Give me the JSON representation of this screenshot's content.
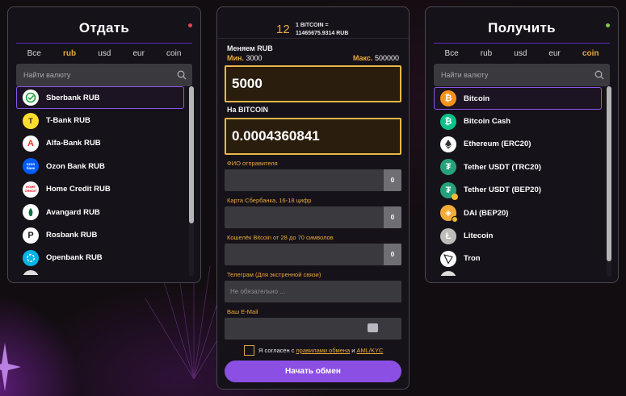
{
  "colors": {
    "accent_orange": "#e8a93a",
    "accent_purple": "#8b4fe3",
    "give_status_dot": "#e8414c",
    "get_status_dot": "#7ecb3f",
    "panel_bg": "#16121a"
  },
  "give": {
    "title": "Отдать",
    "tabs": [
      {
        "label": "Все",
        "active": false
      },
      {
        "label": "rub",
        "active": true
      },
      {
        "label": "usd",
        "active": false
      },
      {
        "label": "eur",
        "active": false
      },
      {
        "label": "coin",
        "active": false
      }
    ],
    "search_placeholder": "Найти валюту",
    "scroll_fraction": {
      "start": 0.0,
      "end": 0.72
    },
    "items": [
      {
        "label": "Sberbank RUB",
        "icon": "sberbank-icon",
        "selected": true
      },
      {
        "label": "T-Bank RUB",
        "icon": "tbank-icon",
        "glyph": "T"
      },
      {
        "label": "Alfa-Bank RUB",
        "icon": "alfabank-icon",
        "glyph": "A"
      },
      {
        "label": "Ozon Bank RUB",
        "icon": "ozonbank-icon",
        "glyph": "ozon\nбанк"
      },
      {
        "label": "Home Credit RUB",
        "icon": "homecredit-icon",
        "glyph": "HOME\nCREDIT"
      },
      {
        "label": "Avangard RUB",
        "icon": "avangard-icon"
      },
      {
        "label": "Rosbank RUB",
        "icon": "rosbank-icon",
        "glyph": "P"
      },
      {
        "label": "Openbank RUB",
        "icon": "openbank-icon"
      }
    ]
  },
  "exchange": {
    "rate_number": "12",
    "rate_line1": "1 BITCOIN =",
    "rate_line2": "11465675.9314 RUB",
    "from_label": "Меняем RUB",
    "min_label": "Мин.",
    "min_value": "3000",
    "max_label": "Макс.",
    "max_value": "500000",
    "from_amount": "5000",
    "to_label": "На BITCOIN",
    "to_amount": "0.0004360841",
    "fields": [
      {
        "label": "ФИО отправителя",
        "placeholder": "",
        "side_button": "0"
      },
      {
        "label": "Карта Сбербанка, 16-18 цифр",
        "placeholder": "",
        "side_button": "0"
      },
      {
        "label": "Кошелёк Bitcoin от 28 до 70 символов",
        "placeholder": "",
        "side_button": "0"
      },
      {
        "label": "Телеграм (Для экстренной связи)",
        "placeholder": "Не обязательно ..."
      },
      {
        "label": "Ваш E-Mail",
        "placeholder": ""
      }
    ],
    "agree_prefix": "Я согласен с",
    "agree_link1": "правилами обмена",
    "agree_and": "и",
    "agree_link2": "AML/KYC",
    "submit_label": "Начать обмен"
  },
  "get": {
    "title": "Получить",
    "tabs": [
      {
        "label": "Все",
        "active": false
      },
      {
        "label": "rub",
        "active": false
      },
      {
        "label": "usd",
        "active": false
      },
      {
        "label": "eur",
        "active": false
      },
      {
        "label": "coin",
        "active": true
      }
    ],
    "search_placeholder": "Найти валюту",
    "scroll_fraction": {
      "start": 0.0,
      "end": 0.92
    },
    "items": [
      {
        "label": "Bitcoin",
        "icon": "bitcoin-icon",
        "selected": true
      },
      {
        "label": "Bitcoin Cash",
        "icon": "bitcoin-cash-icon"
      },
      {
        "label": "Ethereum (ERC20)",
        "icon": "ethereum-icon"
      },
      {
        "label": "Tether USDT (TRC20)",
        "icon": "tether-trc20-icon"
      },
      {
        "label": "Tether USDT (BEP20)",
        "icon": "tether-bep20-icon"
      },
      {
        "label": "DAI (BEP20)",
        "icon": "dai-icon"
      },
      {
        "label": "Litecoin",
        "icon": "litecoin-icon"
      },
      {
        "label": "Tron",
        "icon": "tron-icon"
      }
    ]
  }
}
